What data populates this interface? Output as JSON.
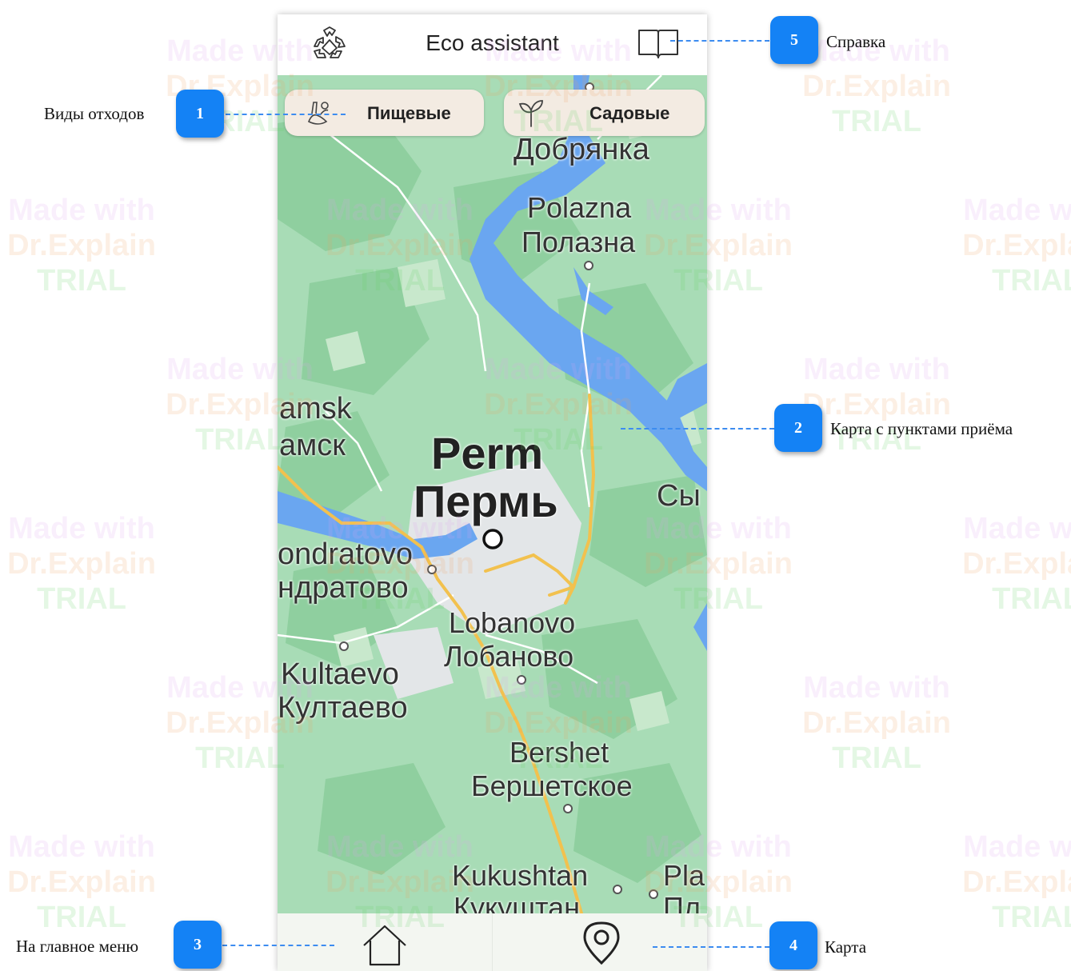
{
  "app": {
    "title": "Eco assistant"
  },
  "chips": [
    {
      "label": "Пищевые",
      "icon": "food-waste-icon"
    },
    {
      "label": "Садовые",
      "icon": "sprout-icon"
    }
  ],
  "header_icons": {
    "left": "recycle-icon",
    "right": "book-icon"
  },
  "bottom_nav": [
    {
      "icon": "home-icon"
    },
    {
      "icon": "map-pin-icon"
    }
  ],
  "map_labels": {
    "dobryanka": "Добрянка",
    "polazna_en": "Polazna",
    "polazna_ru": "Полазна",
    "kamsk_en": "amsk",
    "kamsk_ru": "амск",
    "perm_en": "Perm",
    "perm_ru": "Пермь",
    "sy": "Сы",
    "kondratovo_en": "ondratovo",
    "kondratovo_ru": "ндратово",
    "lobanovo_en": "Lobanovo",
    "lobanovo_ru": "Лобаново",
    "kultaevo_en": "Kultaevo",
    "kultaevo_ru": "Култаево",
    "bershet_en": "Bershet",
    "bershet_ru": "Бершетское",
    "kukushtan_en": "Kukushtan",
    "kukushtan_ru": "Кукуштан",
    "pla_en": "Pla",
    "pla_ru": "Пл"
  },
  "callouts": [
    {
      "number": "1",
      "text": "Виды отходов"
    },
    {
      "number": "2",
      "text": "Карта с пунктами приёма"
    },
    {
      "number": "3",
      "text": "На главное меню"
    },
    {
      "number": "4",
      "text": "Карта"
    },
    {
      "number": "5",
      "text": "Справка"
    }
  ],
  "watermark": {
    "line1": "Made with",
    "line2": "Dr.Explain",
    "line3": "TRIAL"
  },
  "colors": {
    "badge": "#1482f5",
    "map_green": "#a8dcb6",
    "water": "#6aa6f0",
    "chip_bg": "#f3ebe2"
  }
}
